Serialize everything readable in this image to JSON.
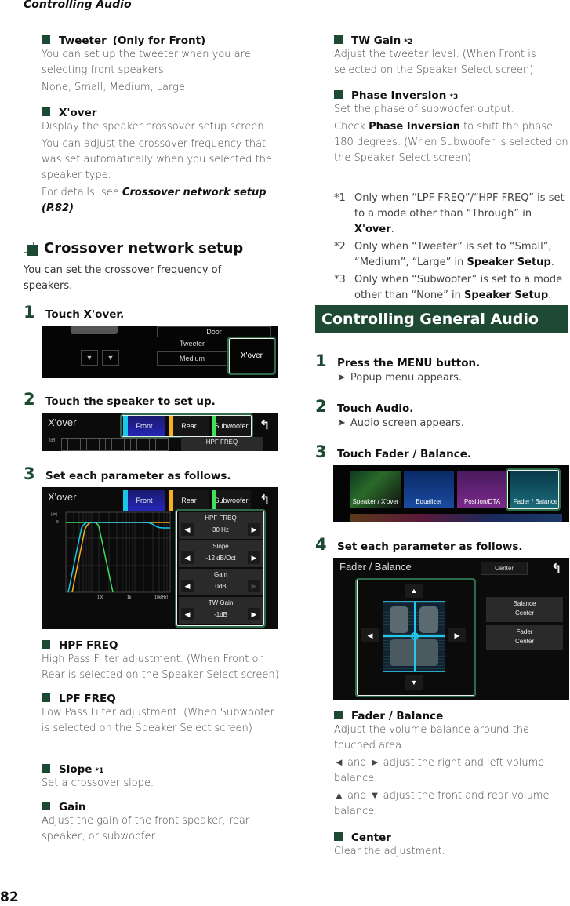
{
  "header": {
    "running_head": "Controlling Audio",
    "page_number": "82"
  },
  "left": {
    "tweeter": {
      "title": "Tweeter",
      "suffix": "(Only for Front)",
      "desc": "You can set up the tweeter when you are selecting front speakers.",
      "options": "None, Small, Medium, Large"
    },
    "xover": {
      "title": "X'over",
      "desc1": "Display the speaker crossover setup screen.",
      "desc2": "You can adjust the crossover frequency that was set automatically when you selected the speaker type.",
      "ref_prefix": "For details, see ",
      "ref_link": "Crossover network setup (P.82)"
    },
    "section": {
      "title": "Crossover network setup",
      "intro": "You can set the crossover frequency of speakers."
    },
    "steps": [
      {
        "num": "1",
        "text": "Touch ",
        "bold": "X'over",
        "end": "."
      },
      {
        "num": "2",
        "text": "Touch the speaker to set up."
      },
      {
        "num": "3",
        "text": "Set each parameter as follows."
      }
    ],
    "screen1": {
      "door_label": "Door",
      "tweeter_label": "Tweeter",
      "tweeter_value": "Medium",
      "xover_button": "X'over"
    },
    "screen2": {
      "title": "X'over",
      "tabs": [
        "Front",
        "Rear",
        "Subwoofer"
      ],
      "param_label": "HPF FREQ",
      "db_label": "[dB]"
    },
    "screen3": {
      "title": "X'over",
      "tabs": [
        {
          "label": "Front",
          "color": "#19c8e8"
        },
        {
          "label": "Rear",
          "color": "#f5b21e"
        },
        {
          "label": "Subwoofer",
          "color": "#3fe05a"
        }
      ],
      "params": [
        {
          "label": "HPF FREQ",
          "value": "30 Hz"
        },
        {
          "label": "Slope",
          "value": "-12 dB/Oct"
        },
        {
          "label": "Gain",
          "value": "0dB"
        },
        {
          "label": "TW Gain",
          "value": "-1dB"
        }
      ],
      "graph": {
        "y_label": "[dB]",
        "y_zero": "0",
        "x_ticks": [
          "100",
          "1k",
          "10k[Hz]"
        ]
      }
    },
    "items": [
      {
        "title": "HPF FREQ",
        "sup": "",
        "desc": "High Pass Filter adjustment. (When Front or Rear is selected on the Speaker Select screen)"
      },
      {
        "title": "LPF FREQ",
        "sup": "",
        "desc": "Low Pass Filter adjustment. (When Subwoofer is selected on the Speaker Select screen)"
      },
      {
        "title": "Slope",
        "sup": "*1",
        "desc": "Set a crossover slope."
      },
      {
        "title": "Gain",
        "sup": "",
        "desc": "Adjust the gain of the front speaker, rear speaker, or subwoofer."
      }
    ]
  },
  "right": {
    "items": [
      {
        "title": "TW Gain",
        "sup": "*2",
        "desc": "Adjust the tweeter level. (When Front is selected on the Speaker Select screen)"
      },
      {
        "title": "Phase Inversion",
        "sup": "*3",
        "desc": "Set the phase of subwoofer output.",
        "desc2_pre": "Check ",
        "desc2_bold": "Phase Inversion",
        "desc2_post": " to shift the phase 180 degrees. (When Subwoofer is selected on the Speaker Select screen)"
      }
    ],
    "footnotes": [
      {
        "mark": "*1",
        "text": "Only when “LPF FREQ”/“HPF FREQ” is set to a mode other than “Through” in ",
        "bold": "X'over",
        "end": "."
      },
      {
        "mark": "*2",
        "text": "Only when “Tweeter” is set to “Small”, “Medium”, “Large” in ",
        "bold": "Speaker Setup",
        "end": "."
      },
      {
        "mark": "*3",
        "text": "Only when “Subwoofer” is set to a mode other than “None” in ",
        "bold": "Speaker Setup",
        "end": "."
      }
    ],
    "banner": "Controlling General Audio",
    "steps": [
      {
        "num": "1",
        "pre": "Press the ",
        "bold": "MENU",
        "post": " button.",
        "result": "Popup menu appears."
      },
      {
        "num": "2",
        "pre": "Touch ",
        "bold": "Audio",
        "post": ".",
        "result": "Audio screen appears."
      },
      {
        "num": "3",
        "pre": "Touch ",
        "bold": "Fader / Balance",
        "post": "."
      },
      {
        "num": "4",
        "pre": "Set each parameter as follows."
      }
    ],
    "audio_menu": {
      "tiles": [
        "Speaker / X'over",
        "Equalizer",
        "Position/DTA",
        "Fader / Balance"
      ]
    },
    "fader_screen": {
      "title": "Fader / Balance",
      "center_button": "Center",
      "balance_label": "Balance",
      "balance_value": "Center",
      "fader_label": "Fader",
      "fader_value": "Center"
    },
    "fb_items": [
      {
        "title": "Fader / Balance",
        "desc": "Adjust the volume balance around the touched area.",
        "lr_left": "◄",
        "lr_mid": " and ",
        "lr_right": "►",
        "lr_text": " adjust the right and left volume balance.",
        "ud_up": "▲",
        "ud_mid": " and ",
        "ud_down": "▼",
        "ud_text": " adjust the front and rear volume balance."
      },
      {
        "title": "Center",
        "desc": "Clear the adjustment."
      }
    ]
  },
  "colors": {
    "accent_green": "#1e4a33",
    "highlight_border": "#2e6b4a",
    "front": "#19c8e8",
    "rear": "#f5b21e",
    "sub": "#3fe05a"
  }
}
